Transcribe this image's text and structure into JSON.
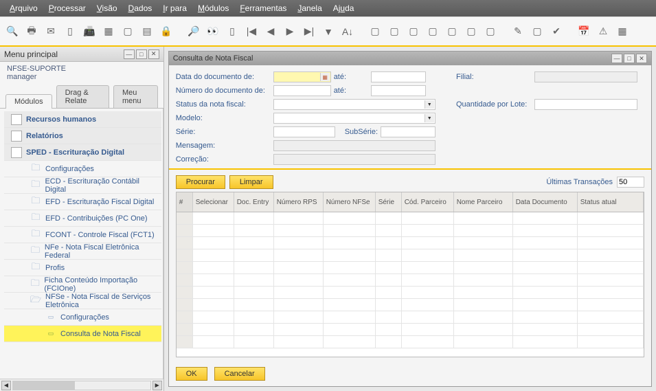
{
  "menubar": {
    "items": [
      "Arquivo",
      "Processar",
      "Visão",
      "Dados",
      "Ir para",
      "Módulos",
      "Ferramentas",
      "Janela",
      "Ajuda"
    ]
  },
  "left": {
    "title": "Menu principal",
    "company": "NFSE-SUPORTE",
    "user": "manager",
    "tabs": {
      "modulos": "Módulos",
      "drag": "Drag & Relate",
      "meu": "Meu menu"
    },
    "tree": {
      "rh": "Recursos humanos",
      "rel": "Relatórios",
      "sped": "SPED - Escrituração Digital",
      "cfg": "Configurações",
      "ecd": "ECD - Escrituração Contábil Digital",
      "efd": "EFD - Escrituração Fiscal Digital",
      "efdc": "EFD - Contribuições (PC One)",
      "fcont": "FCONT - Controle Fiscal (FCT1)",
      "nfe": "NFe - Nota Fiscal Eletrônica Federal",
      "profis": "Profis",
      "ficha": "Ficha Conteúdo Importação (FCIOne)",
      "nfse": "NFSe - Nota Fiscal de Serviços Eletrônica",
      "nfse_cfg": "Configurações",
      "nfse_consulta": "Consulta de Nota Fiscal"
    }
  },
  "right": {
    "title": "Consulta de Nota Fiscal",
    "labels": {
      "dataDocDe": "Data do documento de:",
      "ate": "até:",
      "numDocDe": "Número do documento de:",
      "status": "Status da nota fiscal:",
      "modelo": "Modelo:",
      "serie": "Série:",
      "subserie": "SubSérie:",
      "mensagem": "Mensagem:",
      "correcao": "Correção:",
      "filial": "Filial:",
      "qtdLote": "Quantidade por Lote:",
      "ultTrans": "Últimas Transações"
    },
    "values": {
      "dataDe": "",
      "dataAte": "",
      "numDe": "",
      "numAte": "",
      "status": "",
      "modelo": "",
      "serie": "",
      "subserie": "",
      "mensagem": "",
      "correcao": "",
      "filial": "",
      "qtdLote": "",
      "ultTrans": "50"
    },
    "buttons": {
      "procurar": "Procurar",
      "limpar": "Limpar",
      "ok": "OK",
      "cancelar": "Cancelar"
    },
    "grid": {
      "columns": [
        "Selecionar",
        "Doc. Entry",
        "Número RPS",
        "Número NFSe",
        "Série",
        "Cód. Parceiro",
        "Nome Parceiro",
        "Data Documento",
        "Status atual"
      ],
      "rows": [
        null,
        null,
        null,
        null,
        null,
        null,
        null,
        null,
        null,
        null,
        null
      ]
    }
  }
}
